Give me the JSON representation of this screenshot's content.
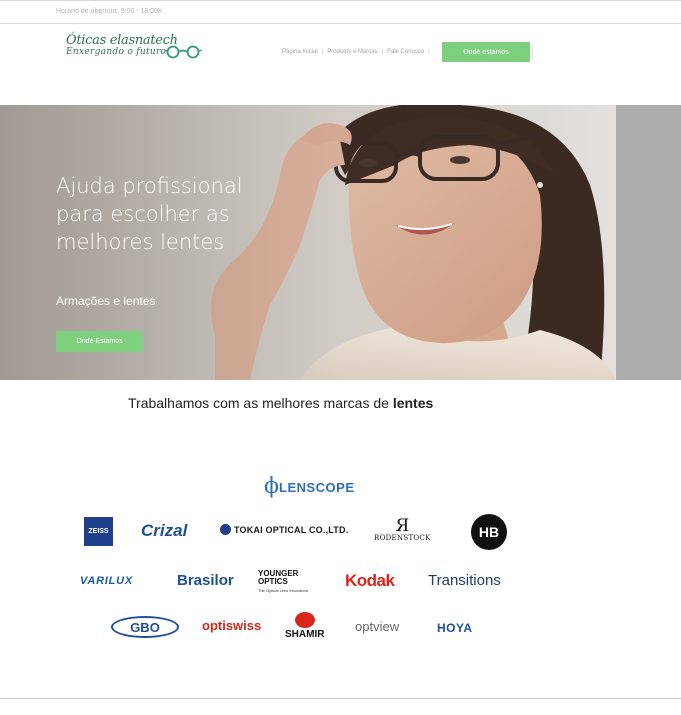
{
  "topbar": {
    "hours": "Horário de abertura: 9:00 - 18:00h"
  },
  "logo": {
    "brand": "Óticas elasnatech",
    "tagline": "Enxergando o futuro",
    "icon": "glasses-icon"
  },
  "nav": {
    "items": [
      "Página Inicial",
      "Produtos e Marcas",
      "Fale Conosco"
    ],
    "cta": "Onde estamos"
  },
  "hero": {
    "title": "Ajuda profissional para escolher as melhores lentes",
    "subtitle": "Armações e lentes",
    "cta": "Onde Estamos"
  },
  "brands": {
    "heading_prefix": "Trabalhamos com as melhores marcas de",
    "heading_bold": "lentes",
    "logos": {
      "lenscope": "LENSCOPE",
      "zeiss": "ZEISS",
      "crizal": "Crizal",
      "tokai": "TOKAI OPTICAL CO.,LTD.",
      "rodenstock": "RODENSTOCK",
      "hb": "HB",
      "varilux": "VARILUX",
      "brasilor": "Brasilor",
      "younger": "YOUNGER OPTICS",
      "younger_tag": "The Optical Lens Innovators",
      "kodak": "Kodak",
      "transitions": "Transitions",
      "gbo": "GBO",
      "optiswiss": "optiswiss",
      "shamir": "SHAMIR",
      "optview": "optview",
      "hoya": "HOYA"
    }
  },
  "colors": {
    "accent": "#7ed07e",
    "brand_green": "#2f6f4f"
  }
}
